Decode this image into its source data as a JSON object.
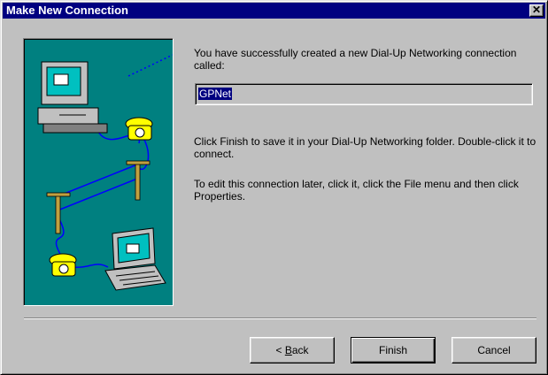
{
  "window": {
    "title": "Make New Connection",
    "close_glyph": "✕"
  },
  "content": {
    "intro": "You have successfully created a new Dial-Up Networking connection called:",
    "connection_name": "GPNet",
    "finish_hint": "Click Finish to save it in your Dial-Up Networking folder. Double-click it to connect.",
    "edit_hint": "To edit this connection later, click it, click the File menu and then click Properties."
  },
  "buttons": {
    "back_prefix": "< ",
    "back_accel": "B",
    "back_rest": "ack",
    "finish": "Finish",
    "cancel": "Cancel"
  },
  "illustration": {
    "icons": [
      "desktop-computer-icon",
      "telephone-icon",
      "telephone-pole-icon",
      "laptop-icon"
    ],
    "colors": {
      "background": "#008080",
      "cable": "#0000ff",
      "phone": "#ffff00",
      "screen": "#00c0c0"
    }
  }
}
